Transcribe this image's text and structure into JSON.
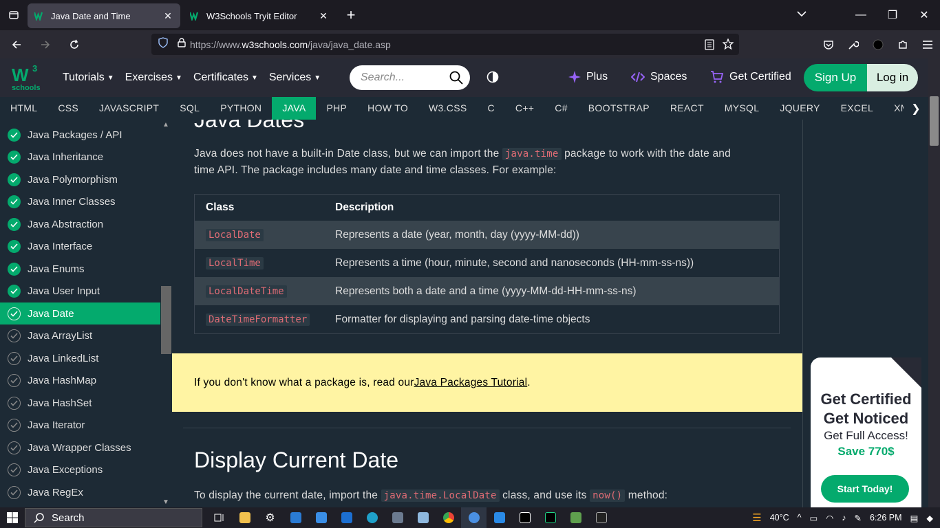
{
  "browser": {
    "tabs": [
      {
        "title": "Java Date and Time",
        "active": true
      },
      {
        "title": "W3Schools Tryit Editor",
        "active": false
      }
    ],
    "url_prefix": "https://www.",
    "url_domain": "w3schools.com",
    "url_path": "/java/java_date.asp"
  },
  "w3nav": {
    "logo_top": "W",
    "logo_sup": "3",
    "logo_sub": "schools",
    "menus": [
      "Tutorials",
      "Exercises",
      "Certificates",
      "Services"
    ],
    "search_placeholder": "Search...",
    "plus": "Plus",
    "spaces": "Spaces",
    "get_certified": "Get Certified",
    "sign_up": "Sign Up",
    "log_in": "Log in"
  },
  "subjects": [
    "HTML",
    "CSS",
    "JAVASCRIPT",
    "SQL",
    "PYTHON",
    "JAVA",
    "PHP",
    "HOW TO",
    "W3.CSS",
    "C",
    "C++",
    "C#",
    "BOOTSTRAP",
    "REACT",
    "MYSQL",
    "JQUERY",
    "EXCEL",
    "XML"
  ],
  "active_subject": "JAVA",
  "sidebar": {
    "items": [
      {
        "label": "Java Packages / API",
        "status": "done"
      },
      {
        "label": "Java Inheritance",
        "status": "done"
      },
      {
        "label": "Java Polymorphism",
        "status": "done"
      },
      {
        "label": "Java Inner Classes",
        "status": "done"
      },
      {
        "label": "Java Abstraction",
        "status": "done"
      },
      {
        "label": "Java Interface",
        "status": "done"
      },
      {
        "label": "Java Enums",
        "status": "done"
      },
      {
        "label": "Java User Input",
        "status": "done"
      },
      {
        "label": "Java Date",
        "status": "current"
      },
      {
        "label": "Java ArrayList",
        "status": "todo"
      },
      {
        "label": "Java LinkedList",
        "status": "todo"
      },
      {
        "label": "Java HashMap",
        "status": "todo"
      },
      {
        "label": "Java HashSet",
        "status": "todo"
      },
      {
        "label": "Java Iterator",
        "status": "todo"
      },
      {
        "label": "Java Wrapper Classes",
        "status": "todo"
      },
      {
        "label": "Java Exceptions",
        "status": "todo"
      },
      {
        "label": "Java RegEx",
        "status": "todo"
      }
    ]
  },
  "main": {
    "heading_cut": "Java Dates",
    "intro_part1": "Java does not have a built-in Date class, but we can import the ",
    "intro_code": "java.time",
    "intro_part2": " package to work with the date and",
    "intro_line2": "time API. The package includes many date and time classes. For example:",
    "table": {
      "headers": [
        "Class",
        "Description"
      ],
      "rows": [
        [
          "LocalDate",
          "Represents a date (year, month, day (yyyy-MM-dd))"
        ],
        [
          "LocalTime",
          "Represents a time (hour, minute, second and nanoseconds (HH-mm-ss-ns))"
        ],
        [
          "LocalDateTime",
          "Represents both a date and a time (yyyy-MM-dd-HH-mm-ss-ns)"
        ],
        [
          "DateTimeFormatter",
          "Formatter for displaying and parsing date-time objects"
        ]
      ]
    },
    "note_text": "If you don't know what a package is, read our ",
    "note_link": "Java Packages Tutorial",
    "note_end": ".",
    "h2": "Display Current Date",
    "display_part1": "To display the current date, import the ",
    "display_code1": "java.time.LocalDate",
    "display_part2": " class, and use its ",
    "display_code2": "now()",
    "display_part3": " method:"
  },
  "ad": {
    "line1": "Get Certified",
    "line2": "Get Noticed",
    "line3": "Get Full Access!",
    "line4": "Save 770$",
    "button": "Start Today!"
  },
  "taskbar": {
    "search": "Search",
    "temperature": "40°C",
    "time": "6:26 PM"
  },
  "colors": {
    "accent": "#04aa6d",
    "note_bg": "#fff4a3",
    "code": "#e06c75"
  }
}
